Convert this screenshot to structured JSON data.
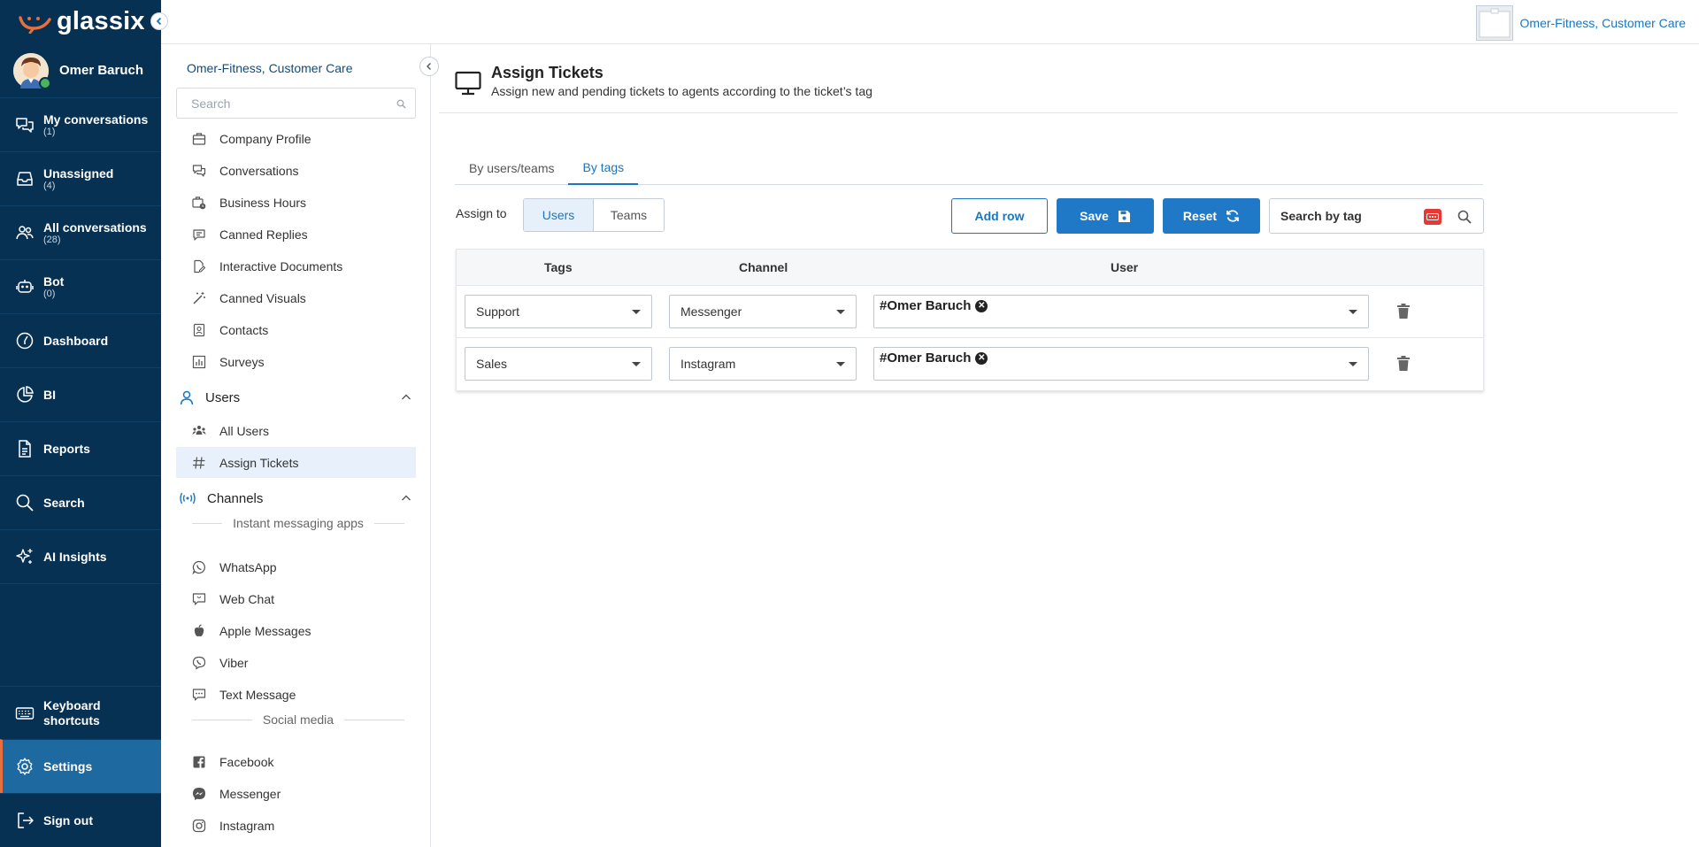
{
  "brand": {
    "name": "glassix",
    "accent": "#e86f3e",
    "nav_bg": "#063152",
    "primary": "#1f79c6"
  },
  "profile": {
    "name": "Omer Baruch"
  },
  "nav": {
    "items": [
      {
        "label": "My conversations",
        "count": "(1)",
        "icon": "chat-icon"
      },
      {
        "label": "Unassigned",
        "count": "(4)",
        "icon": "inbox-icon"
      },
      {
        "label": "All conversations",
        "count": "(28)",
        "icon": "users-icon"
      },
      {
        "label": "Bot",
        "count": "(0)",
        "icon": "bot-icon"
      },
      {
        "label": "Dashboard",
        "icon": "dashboard-icon"
      },
      {
        "label": "BI",
        "icon": "pie-chart-icon"
      },
      {
        "label": "Reports",
        "icon": "report-icon"
      },
      {
        "label": "Search",
        "icon": "search-icon"
      },
      {
        "label": "AI Insights",
        "icon": "sparkle-icon"
      }
    ],
    "bottom": [
      {
        "label": "Keyboard shortcuts",
        "icon": "keyboard-icon"
      },
      {
        "label": "Settings",
        "icon": "gear-icon",
        "active": true
      },
      {
        "label": "Sign out",
        "icon": "sign-out-icon"
      }
    ]
  },
  "header": {
    "company": "Omer-Fitness, Customer Care"
  },
  "settings": {
    "title": "Omer-Fitness, Customer Care",
    "search_placeholder": "Search",
    "items": {
      "company_profile": "Company Profile",
      "conversations": "Conversations",
      "business_hours": "Business Hours",
      "canned_replies": "Canned Replies",
      "interactive_documents": "Interactive Documents",
      "canned_visuals": "Canned Visuals",
      "contacts": "Contacts",
      "surveys": "Surveys"
    },
    "users_section": "Users",
    "users_items": {
      "all_users": "All Users",
      "assign_tickets": "Assign Tickets"
    },
    "channels_section": "Channels",
    "im_divider": "Instant messaging apps",
    "im_items": {
      "whatsapp": "WhatsApp",
      "web_chat": "Web Chat",
      "apple": "Apple Messages",
      "viber": "Viber",
      "sms": "Text Message"
    },
    "social_divider": "Social media",
    "social_items": {
      "facebook": "Facebook",
      "messenger": "Messenger",
      "instagram": "Instagram"
    }
  },
  "page": {
    "title": "Assign Tickets",
    "subtitle": "Assign new and pending tickets to agents according to the ticket’s tag",
    "tabs": [
      "By users/teams",
      "By tags"
    ],
    "active_tab": 1,
    "assign_to_label": "Assign to",
    "assign_options": [
      "Users",
      "Teams"
    ],
    "buttons": {
      "add_row": "Add row",
      "save": "Save",
      "reset": "Reset"
    },
    "tag_search_placeholder": "Search by tag",
    "table": {
      "headers": {
        "tags": "Tags",
        "channel": "Channel",
        "user": "User"
      },
      "rows": [
        {
          "tag": "Support",
          "channel": "Messenger",
          "user": "#Omer Baruch"
        },
        {
          "tag": "Sales",
          "channel": "Instagram",
          "user": "#Omer Baruch"
        }
      ]
    }
  }
}
